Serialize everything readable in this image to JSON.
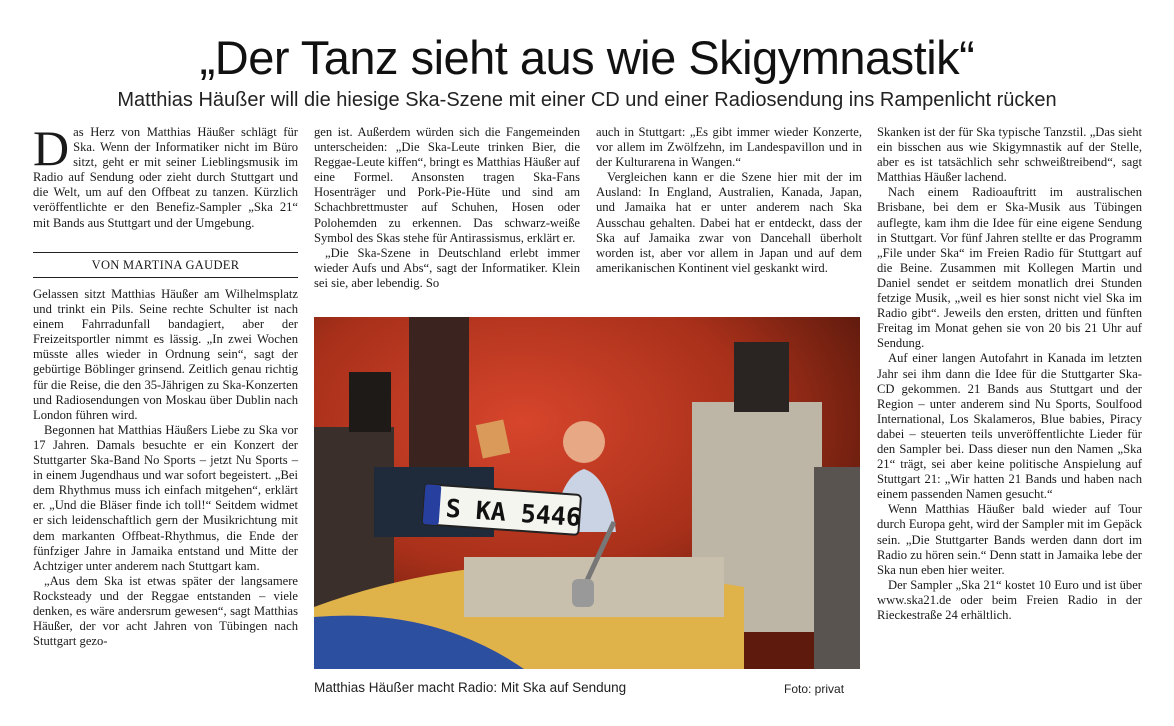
{
  "article": {
    "headline": "„Der Tanz sieht aus wie Skigymnastik“",
    "subheadline": "Matthias Häußer will die hiesige Ska-Szene mit einer CD und einer Radiosendung ins Rampenlicht rücken",
    "byline": "VON MARTINA GAUDER",
    "dropcap": "D",
    "lead": "as Herz von Matthias Häußer schlägt für Ska. Wenn der Informatiker nicht im Büro sitzt, geht er mit seiner Lieblingsmusik im Radio auf Sendung oder zieht durch Stuttgart und die Welt, um auf den Offbeat zu tanzen. Kürzlich veröffentlichte er den Benefiz-Sampler „Ska 21“ mit Bands aus Stuttgart und der Umgebung.",
    "col1": [
      "Gelassen sitzt Matthias Häußer am Wilhelmsplatz und trinkt ein Pils. Seine rechte Schulter ist nach einem Fahrradunfall bandagiert, aber der Freizeitsportler nimmt es lässig. „In zwei Wochen müsste alles wieder in Ordnung sein“, sagt der gebürtige Böblinger grinsend. Zeitlich genau richtig für die Reise, die den 35-Jährigen zu Ska-Konzerten und Radiosendungen von Moskau über Dublin nach London führen wird.",
      "Begonnen hat Matthias Häußers Liebe zu Ska vor 17 Jahren. Damals besuchte er ein Konzert der Stuttgarter Ska-Band No Sports – jetzt Nu Sports – in einem Jugendhaus und war sofort begeistert. „Bei dem Rhythmus muss ich einfach mitgehen“, erklärt er. „Und die Bläser finde ich toll!“ Seitdem widmet er sich leidenschaftlich gern der Musikrichtung mit dem markanten Offbeat-Rhythmus, die Ende der fünfziger Jahre in Jamaika entstand und Mitte der Achtziger unter anderem nach Stuttgart kam.",
      "„Aus dem Ska ist etwas später der langsamere Rocksteady und der Reggae entstanden – viele denken, es wäre andersrum gewesen“, sagt Matthias Häußer, der vor acht Jahren von Tübingen nach Stuttgart gezo-"
    ],
    "col2": [
      "gen ist. Außerdem würden sich die Fangemeinden unterscheiden: „Die Ska-Leute trinken Bier, die Reggae-Leute kiffen“, bringt es Matthias Häußer auf eine Formel. Ansonsten tragen Ska-Fans Hosenträger und Pork-Pie-Hüte und sind am Schachbrettmuster auf Schuhen, Hosen oder Polohemden zu erkennen. Das schwarz-weiße Symbol des Skas stehe für Antirassismus, erklärt er.",
      "„Die Ska-Szene in Deutschland erlebt immer wieder Aufs und Abs“, sagt der Informatiker. Klein sei sie, aber lebendig. So"
    ],
    "col3": [
      "auch in Stuttgart: „Es gibt immer wieder Konzerte, vor allem im Zwölfzehn, im Landespavillon und in der Kulturarena in Wangen.“",
      "Vergleichen kann er die Szene hier mit der im Ausland: In England, Australien, Kanada, Japan, und Jamaika hat er unter anderem nach Ska Ausschau gehalten. Dabei hat er entdeckt, dass der Ska auf Jamaika zwar von Dancehall überholt worden ist, aber vor allem in Japan und auf dem amerikanischen Kontinent viel geskankt wird."
    ],
    "col4": [
      "Skanken ist der für Ska typische Tanzstil. „Das sieht ein bisschen aus wie Skigymnastik auf der Stelle, aber es ist tatsächlich sehr schweißtreibend“, sagt Matthias Häußer lachend.",
      "Nach einem Radioauftritt im australischen Brisbane, bei dem er Ska-Musik aus Tübingen auflegte, kam ihm die Idee für eine eigene Sendung in Stuttgart. Vor fünf Jahren stellte er das Programm „File under Ska“ im Freien Radio für Stuttgart auf die Beine. Zusammen mit Kollegen Martin und Daniel sendet er seitdem monatlich drei Stunden fetzige Musik, „weil es hier sonst nicht viel Ska im Radio gibt“. Jeweils den ersten, dritten und fünften Freitag im Monat gehen sie von 20 bis 21 Uhr auf Sendung.",
      "Auf einer langen Autofahrt in Kanada im letzten Jahr sei ihm dann die Idee für die Stuttgarter Ska-CD gekommen. 21 Bands aus Stuttgart und der Region – unter anderem sind Nu Sports, Soulfood International, Los Skalameros, Blue babies, Piracy dabei – steuerten teils unveröffentlichte Lieder für den Sampler bei. Dass dieser nun den Namen „Ska 21“ trägt, sei aber keine politische Anspielung auf Stuttgart 21: „Wir hatten 21 Bands und haben nach einem passenden Namen gesucht.“",
      "Wenn Matthias Häußer bald wieder auf Tour durch Europa geht, wird der Sampler mit im Gepäck sein. „Die Stuttgarter Bands werden dann dort im Radio zu hören sein.“ Denn statt in Jamaika lebe der Ska nun eben hier weiter.",
      "Der Sampler „Ska 21“ kostet 10 Euro und ist über www.ska21.de oder beim Freien Radio in der Rieckestraße 24 erhältlich."
    ],
    "photo": {
      "plate_text": "S KA 5446",
      "caption": "Matthias Häußer macht Radio: Mit Ska auf Sendung",
      "credit": "Foto: privat"
    }
  }
}
